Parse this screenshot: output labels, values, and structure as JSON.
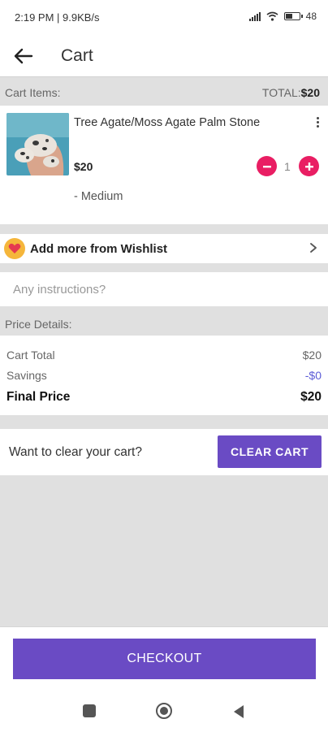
{
  "status_bar": {
    "time": "2:19 PM | 9.9KB/s",
    "battery": "48"
  },
  "app_bar": {
    "title": "Cart",
    "back_icon": "arrow-left-icon"
  },
  "cart": {
    "items_label": "Cart Items:",
    "total_prefix": "TOTAL:",
    "total_value": "$20",
    "items": [
      {
        "name": "Tree Agate/Moss Agate Palm Stone",
        "price": "$20",
        "quantity": "1",
        "variant": "- Medium"
      }
    ]
  },
  "wishlist": {
    "label": "Add more from Wishlist",
    "icon": "heart-icon"
  },
  "instructions": {
    "placeholder": "Any instructions?"
  },
  "price_details": {
    "heading": "Price Details:",
    "cart_total_label": "Cart Total",
    "cart_total_value": "$20",
    "savings_label": "Savings",
    "savings_value": "-$0",
    "final_label": "Final Price",
    "final_value": "$20"
  },
  "clear_cart": {
    "prompt": "Want to clear your cart?",
    "button": "CLEAR CART"
  },
  "checkout": {
    "button": "CHECKOUT"
  },
  "colors": {
    "primary": "#6a4bc4",
    "accent": "#e91e63",
    "savings": "#5b5bd6",
    "wishlist_badge": "#f5b63b"
  }
}
